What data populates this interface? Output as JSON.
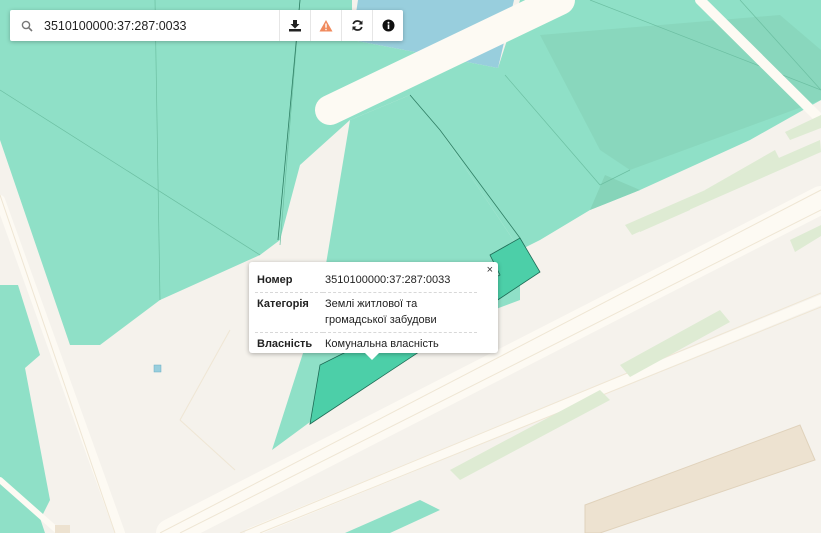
{
  "search": {
    "value": "3510100000:37:287:0033"
  },
  "toolbar": {
    "download_icon": "download-icon",
    "warning_icon": "warning-icon",
    "refresh_icon": "refresh-icon",
    "info_icon": "info-icon"
  },
  "popup": {
    "close": "×",
    "rows": [
      {
        "key": "Номер",
        "value": "3510100000:37:287:0033"
      },
      {
        "key": "Категорія",
        "value": "Землі житлової та громадської забудови"
      },
      {
        "key": "Власність",
        "value": "Комунальна власність"
      }
    ]
  },
  "colors": {
    "background": "#f5f2ec",
    "parcel": "#8fe0c7",
    "parcel_dark": "#89d7bd",
    "selected_parcel": "#4ccfa8",
    "water": "#98cedd",
    "road": "#fdfaf3",
    "green_strip": "#deebd3",
    "building": "#ede2d0",
    "warning": "#f08a5d"
  }
}
